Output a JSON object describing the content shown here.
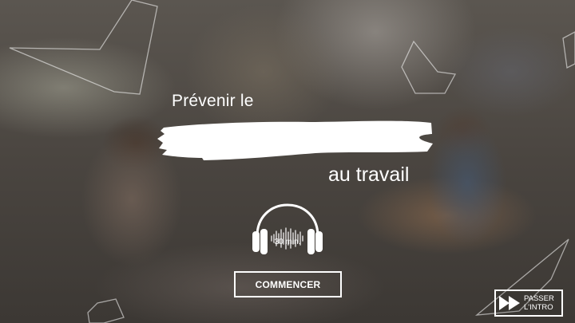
{
  "intro": {
    "title_line1": "Prévenir le",
    "title_line3": "au travail"
  },
  "audio": {
    "duration_label": "30 min."
  },
  "buttons": {
    "start_label": "COMMENCER",
    "skip_line1": "PASSER",
    "skip_line2": "L'INTRO"
  },
  "icons": {
    "headphones": "headphones-icon",
    "skip": "fast-forward-icon"
  },
  "colors": {
    "text": "#ffffff",
    "outline": "#ffffff"
  }
}
